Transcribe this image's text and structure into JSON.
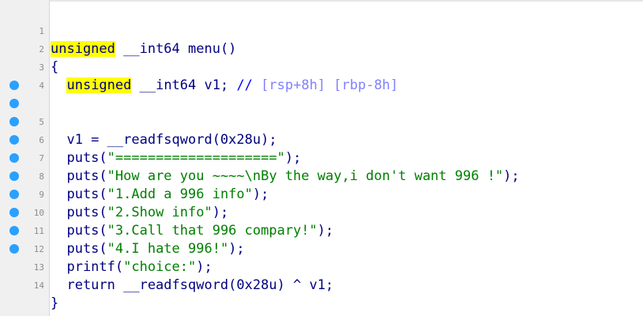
{
  "lines": [
    {
      "num": "1",
      "bp": false,
      "s1": "unsigned",
      "s2": " __int64 menu()"
    },
    {
      "num": "2",
      "bp": false,
      "s1": "{"
    },
    {
      "num": "3",
      "bp": false,
      "s1": "  ",
      "s2": "unsigned",
      "s3": " __int64 v1; ",
      "s4": "// ",
      "s5": "[rsp+8h] [rbp-8h]"
    },
    {
      "num": "4",
      "bp": false
    },
    {
      "num": "5",
      "bp": true,
      "s1": "  v1 = __readfsqword(0x28u);"
    },
    {
      "num": "6",
      "bp": true,
      "s1": "  puts(",
      "s2": "\"====================\"",
      "s3": ");"
    },
    {
      "num": "7",
      "bp": true,
      "s1": "  puts(",
      "s2": "\"How are you ~~~~\\nBy the way,i don't want 996 !\"",
      "s3": ");"
    },
    {
      "num": "8",
      "bp": true,
      "s1": "  puts(",
      "s2": "\"1.Add a 996 info\"",
      "s3": ");"
    },
    {
      "num": "9",
      "bp": true,
      "s1": "  puts(",
      "s2": "\"2.Show info\"",
      "s3": ");"
    },
    {
      "num": "10",
      "bp": true,
      "s1": "  puts(",
      "s2": "\"3.Call that 996 compary!\"",
      "s3": ");"
    },
    {
      "num": "11",
      "bp": true,
      "s1": "  puts(",
      "s2": "\"4.I hate 996!\"",
      "s3": ");"
    },
    {
      "num": "12",
      "bp": true,
      "s1": "  printf(",
      "s2": "\"choice:\"",
      "s3": ");"
    },
    {
      "num": "13",
      "bp": true,
      "s1": "  return __readfsqword(0x28u) ^ v1;"
    },
    {
      "num": "14",
      "bp": true,
      "s1": "}"
    }
  ],
  "colors": {
    "breakpoint": "#2aa0ff",
    "keyword_highlight": "#ffff00",
    "string": "#008000",
    "comment": "#0000ff",
    "code": "#000080"
  }
}
